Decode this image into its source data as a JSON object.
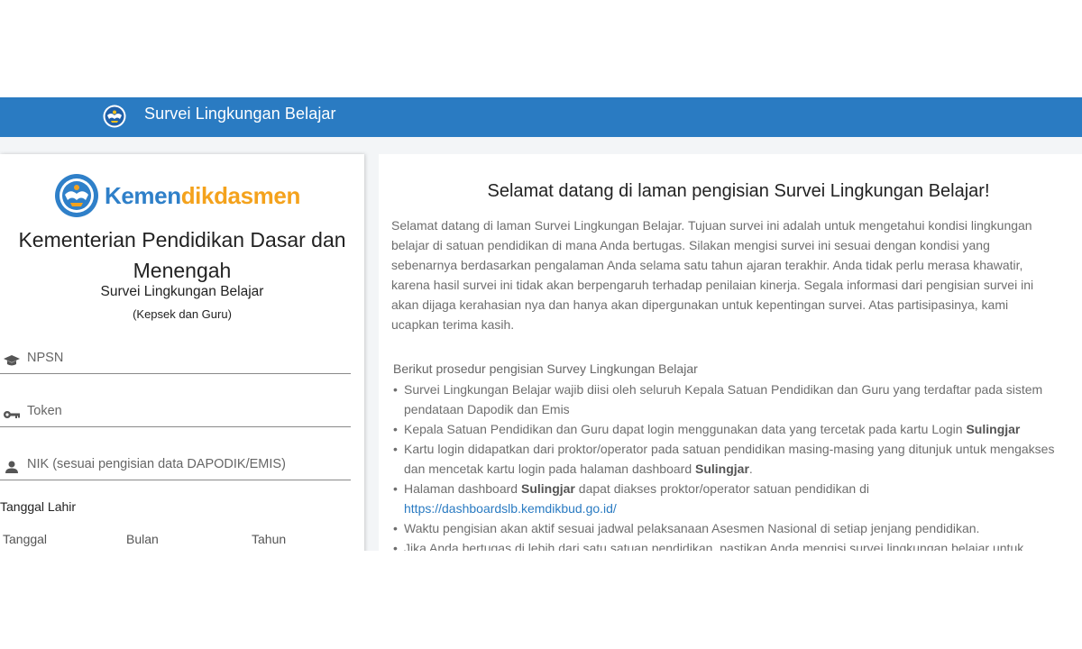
{
  "topbar": {
    "title": "Survei Lingkungan Belajar"
  },
  "login": {
    "brand": {
      "part1": "Kemen",
      "part2": "dikdasmen"
    },
    "ministry_line1": "Kementerian Pendidikan Dasar dan",
    "ministry_line2": "Menengah",
    "survey_name": "Survei Lingkungan Belajar",
    "audience": "(Kepsek dan Guru)",
    "fields": {
      "npsn_placeholder": "NPSN",
      "token_placeholder": "Token",
      "nik_placeholder": "NIK (sesuai pengisian data DAPODIK/EMIS)"
    },
    "dob": {
      "label": "Tanggal Lahir",
      "day": "Tanggal",
      "month": "Bulan",
      "year": "Tahun"
    }
  },
  "content": {
    "title": "Selamat datang di laman pengisian Survei Lingkungan Belajar!",
    "intro": "Selamat datang di laman Survei Lingkungan Belajar. Tujuan survei ini adalah untuk mengetahui kondisi lingkungan belajar di satuan pendidikan di mana Anda bertugas. Silakan mengisi survei ini sesuai dengan kondisi yang sebenarnya berdasarkan pengalaman Anda selama satu tahun ajaran terakhir. Anda tidak perlu merasa khawatir, karena hasil survei ini tidak akan berpengaruh terhadap penilaian kinerja. Segala informasi dari pengisian survei ini akan dijaga kerahasian nya dan hanya akan dipergunakan untuk kepentingan survei. Atas partisipasinya, kami ucapkan terima kasih.",
    "procedure_heading": "Berikut prosedur pengisian Survey Lingkungan Belajar",
    "procedures": {
      "p1": "Survei Lingkungan Belajar wajib diisi oleh seluruh Kepala Satuan Pendidikan dan Guru yang terdaftar pada sistem pendataan Dapodik dan Emis",
      "p2_text": "Kepala Satuan Pendidikan dan Guru dapat login menggunakan data yang tercetak pada kartu Login ",
      "p2_bold": "Sulingjar",
      "p3_text": "Kartu login didapatkan dari proktor/operator pada satuan pendidikan masing-masing yang ditunjuk untuk mengakses dan mencetak kartu login pada halaman dashboard ",
      "p3_bold": "Sulingjar",
      "p3_end": ".",
      "p4_text1": "Halaman dashboard ",
      "p4_bold": "Sulingjar",
      "p4_text2": " dapat diakses proktor/operator satuan pendidikan di",
      "p4_link": "https://dashboardslb.kemdikbud.go.id/",
      "p5": "Waktu pengisian akan aktif sesuai jadwal pelaksanaan Asesmen Nasional di setiap jenjang pendidikan.",
      "p6": "Jika Anda bertugas di lebih dari satu satuan pendidikan, pastikan Anda mengisi survei lingkungan belajar untuk"
    }
  },
  "colors": {
    "topbar": "#2a7bc2",
    "link": "#2a7bc2",
    "brand_blue": "#2f80c9",
    "brand_orange": "#f4a21c"
  }
}
